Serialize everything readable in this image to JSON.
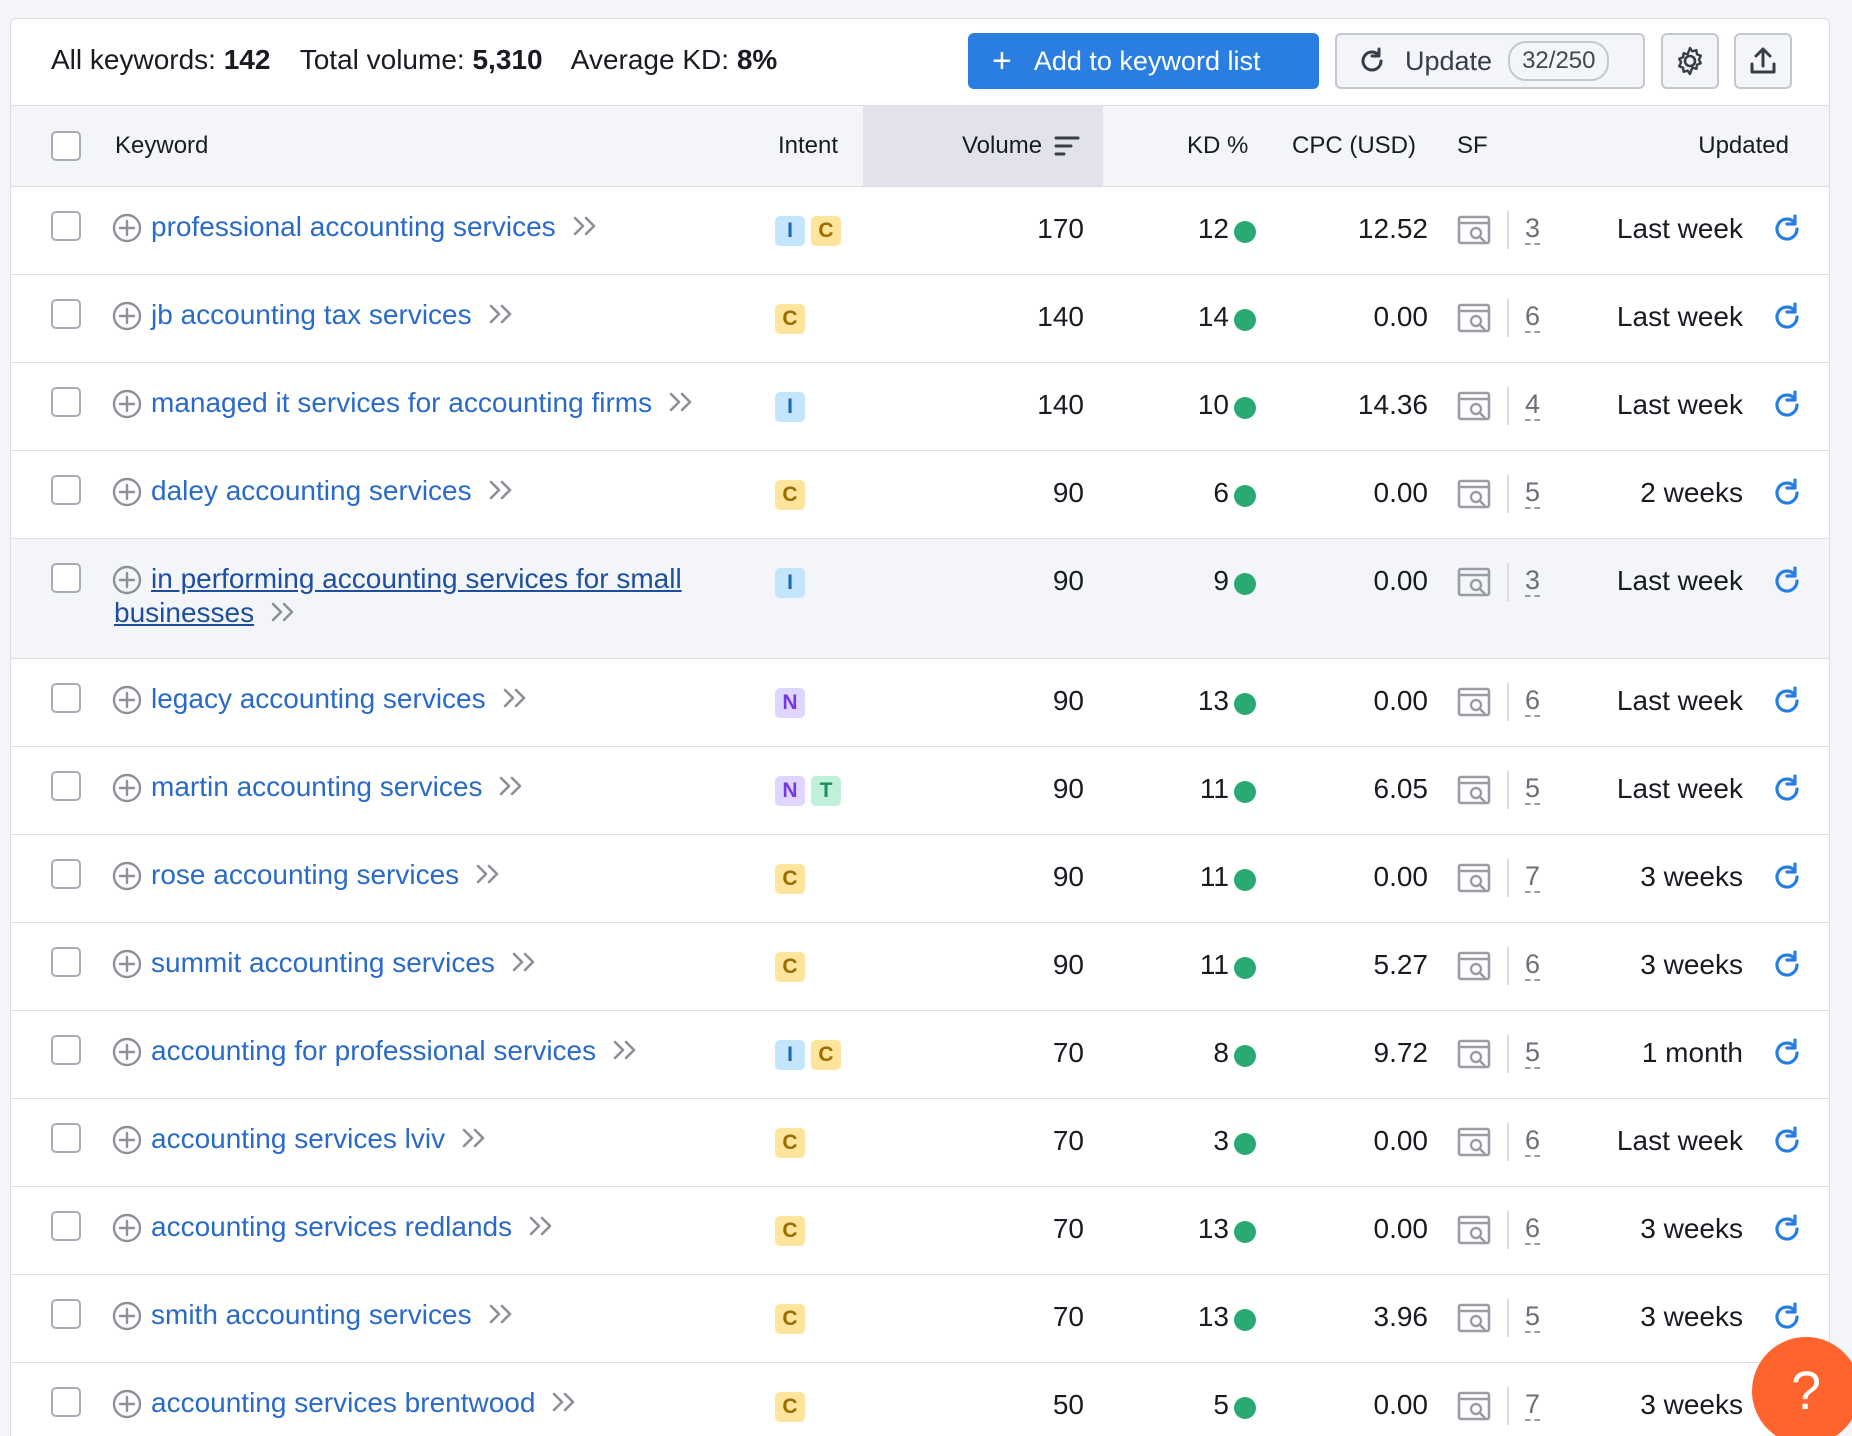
{
  "summary": {
    "all_keywords_label": "All keywords:",
    "all_keywords_value": "142",
    "total_volume_label": "Total volume:",
    "total_volume_value": "5,310",
    "avg_kd_label": "Average KD:",
    "avg_kd_value": "8%"
  },
  "toolbar": {
    "add_label": "Add to keyword list",
    "update_label": "Update",
    "update_count": "32/250",
    "settings_icon": "gear-icon",
    "export_icon": "export-icon"
  },
  "columns": {
    "keyword": "Keyword",
    "intent": "Intent",
    "volume": "Volume",
    "kd": "KD %",
    "cpc": "CPC (USD)",
    "sf": "SF",
    "updated": "Updated"
  },
  "rows": [
    {
      "keyword": "professional accounting services",
      "intent": [
        "I",
        "C"
      ],
      "volume": "170",
      "kd": "12",
      "cpc": "12.52",
      "sf": "3",
      "updated": "Last week"
    },
    {
      "keyword": "jb accounting tax services",
      "intent": [
        "C"
      ],
      "volume": "140",
      "kd": "14",
      "cpc": "0.00",
      "sf": "6",
      "updated": "Last week"
    },
    {
      "keyword": "managed it services for accounting firms",
      "intent": [
        "I"
      ],
      "volume": "140",
      "kd": "10",
      "cpc": "14.36",
      "sf": "4",
      "updated": "Last week"
    },
    {
      "keyword": "daley accounting services",
      "intent": [
        "C"
      ],
      "volume": "90",
      "kd": "6",
      "cpc": "0.00",
      "sf": "5",
      "updated": "2 weeks"
    },
    {
      "keyword": "in performing accounting services for small businesses",
      "intent": [
        "I"
      ],
      "volume": "90",
      "kd": "9",
      "cpc": "0.00",
      "sf": "3",
      "updated": "Last week"
    },
    {
      "keyword": "legacy accounting services",
      "intent": [
        "N"
      ],
      "volume": "90",
      "kd": "13",
      "cpc": "0.00",
      "sf": "6",
      "updated": "Last week"
    },
    {
      "keyword": "martin accounting services",
      "intent": [
        "N",
        "T"
      ],
      "volume": "90",
      "kd": "11",
      "cpc": "6.05",
      "sf": "5",
      "updated": "Last week"
    },
    {
      "keyword": "rose accounting services",
      "intent": [
        "C"
      ],
      "volume": "90",
      "kd": "11",
      "cpc": "0.00",
      "sf": "7",
      "updated": "3 weeks"
    },
    {
      "keyword": "summit accounting services",
      "intent": [
        "C"
      ],
      "volume": "90",
      "kd": "11",
      "cpc": "5.27",
      "sf": "6",
      "updated": "3 weeks"
    },
    {
      "keyword": "accounting for professional services",
      "intent": [
        "I",
        "C"
      ],
      "volume": "70",
      "kd": "8",
      "cpc": "9.72",
      "sf": "5",
      "updated": "1 month"
    },
    {
      "keyword": "accounting services lviv",
      "intent": [
        "C"
      ],
      "volume": "70",
      "kd": "3",
      "cpc": "0.00",
      "sf": "6",
      "updated": "Last week"
    },
    {
      "keyword": "accounting services redlands",
      "intent": [
        "C"
      ],
      "volume": "70",
      "kd": "13",
      "cpc": "0.00",
      "sf": "6",
      "updated": "3 weeks"
    },
    {
      "keyword": "smith accounting services",
      "intent": [
        "C"
      ],
      "volume": "70",
      "kd": "13",
      "cpc": "3.96",
      "sf": "5",
      "updated": "3 weeks"
    },
    {
      "keyword": "accounting services brentwood",
      "intent": [
        "C"
      ],
      "volume": "50",
      "kd": "5",
      "cpc": "0.00",
      "sf": "7",
      "updated": "3 weeks"
    }
  ],
  "colors": {
    "accent": "#2a7de1",
    "link": "#2a6ac8",
    "kd_easy": "#2aaa73",
    "help": "#ff642d"
  },
  "help": {
    "label": "?"
  }
}
